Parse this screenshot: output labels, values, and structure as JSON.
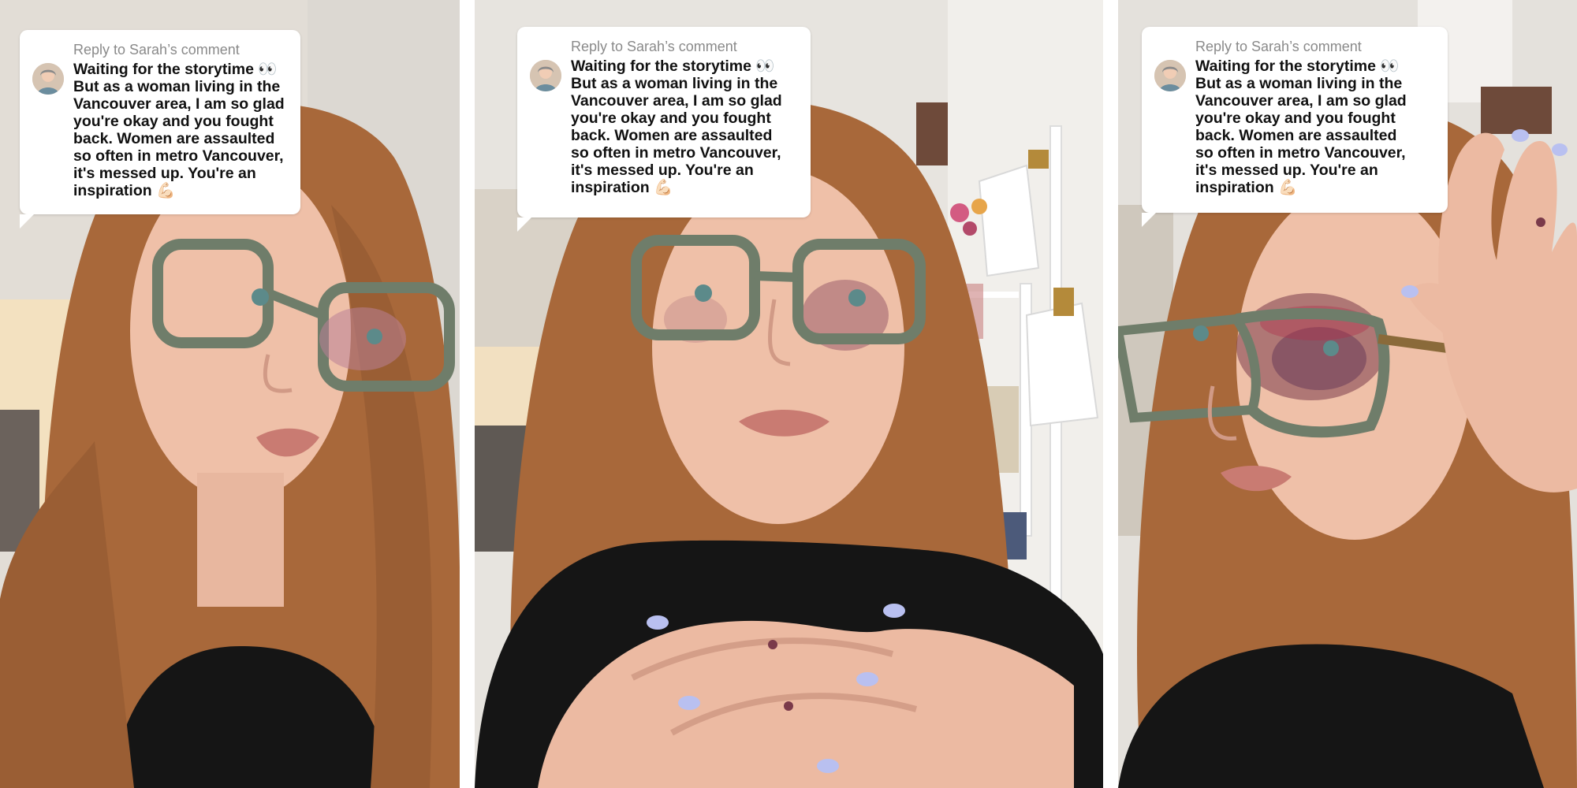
{
  "panels": [
    {
      "reply_label": "Reply to Sarah’s comment",
      "comment_lines": [
        "Waiting for the storytime 👀",
        "But as a woman living in the",
        "Vancouver area, I am so glad",
        "you're okay and you fought",
        "back. Women are assaulted",
        "so often in metro Vancouver,",
        "it's messed up. You're an",
        "inspiration 💪🏻"
      ]
    },
    {
      "reply_label": "Reply to Sarah’s comment",
      "comment_lines": [
        "Waiting for the storytime 👀",
        "But as a woman living in the",
        "Vancouver area, I am so glad",
        "you're okay and you fought",
        "back. Women are assaulted",
        "so often in metro Vancouver,",
        "it's messed up. You're an",
        "inspiration 💪🏻"
      ]
    },
    {
      "reply_label": "Reply to Sarah’s comment",
      "comment_lines": [
        "Waiting for the storytime 👀",
        "But as a woman living in the",
        "Vancouver area, I am so glad",
        "you're okay and you fought",
        "back. Women are assaulted",
        "so often in metro Vancouver,",
        "it's messed up. You're an",
        "inspiration 💪🏻"
      ]
    }
  ],
  "colors": {
    "hair": "#a8683a",
    "skin": "#efc0a8",
    "shirt": "#151515",
    "glasses": "#6f7d6a",
    "bruise": "#7a3a4a",
    "wall": "#e9e6e1",
    "nails": "#b9c0f0"
  }
}
